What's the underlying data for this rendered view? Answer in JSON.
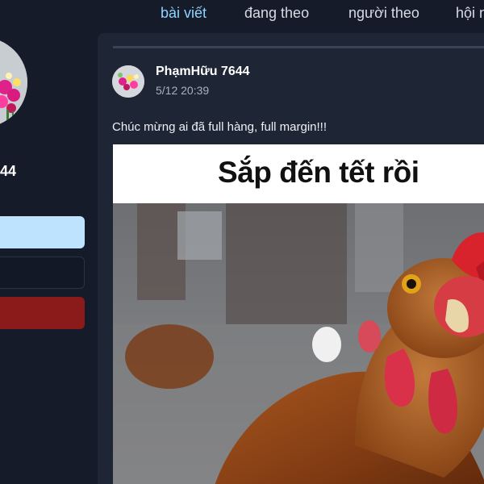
{
  "tabs": [
    {
      "label": "bài viết",
      "active": true
    },
    {
      "label": "đang theo",
      "active": false
    },
    {
      "label": "người theo",
      "active": false
    },
    {
      "label": "hội n",
      "active": false
    }
  ],
  "profile": {
    "name_fragment": "44",
    "buttons": [
      {
        "color": "#bde3ff"
      },
      {
        "color": "#121826"
      },
      {
        "color": "#8b1b1b"
      }
    ]
  },
  "post": {
    "author": "PhạmHữu 7644",
    "timestamp": "5/12 20:39",
    "text": "Chúc mừng ai đã full hàng, full margin!!!",
    "image": {
      "caption": "Sắp đến tết rồi",
      "subject": "chicken-photo"
    }
  },
  "colors": {
    "background": "#151b29",
    "card": "#1e2535",
    "active_tab": "#8fd3ff",
    "accent_red": "#8b1b1b",
    "accent_light_blue": "#bde3ff"
  }
}
